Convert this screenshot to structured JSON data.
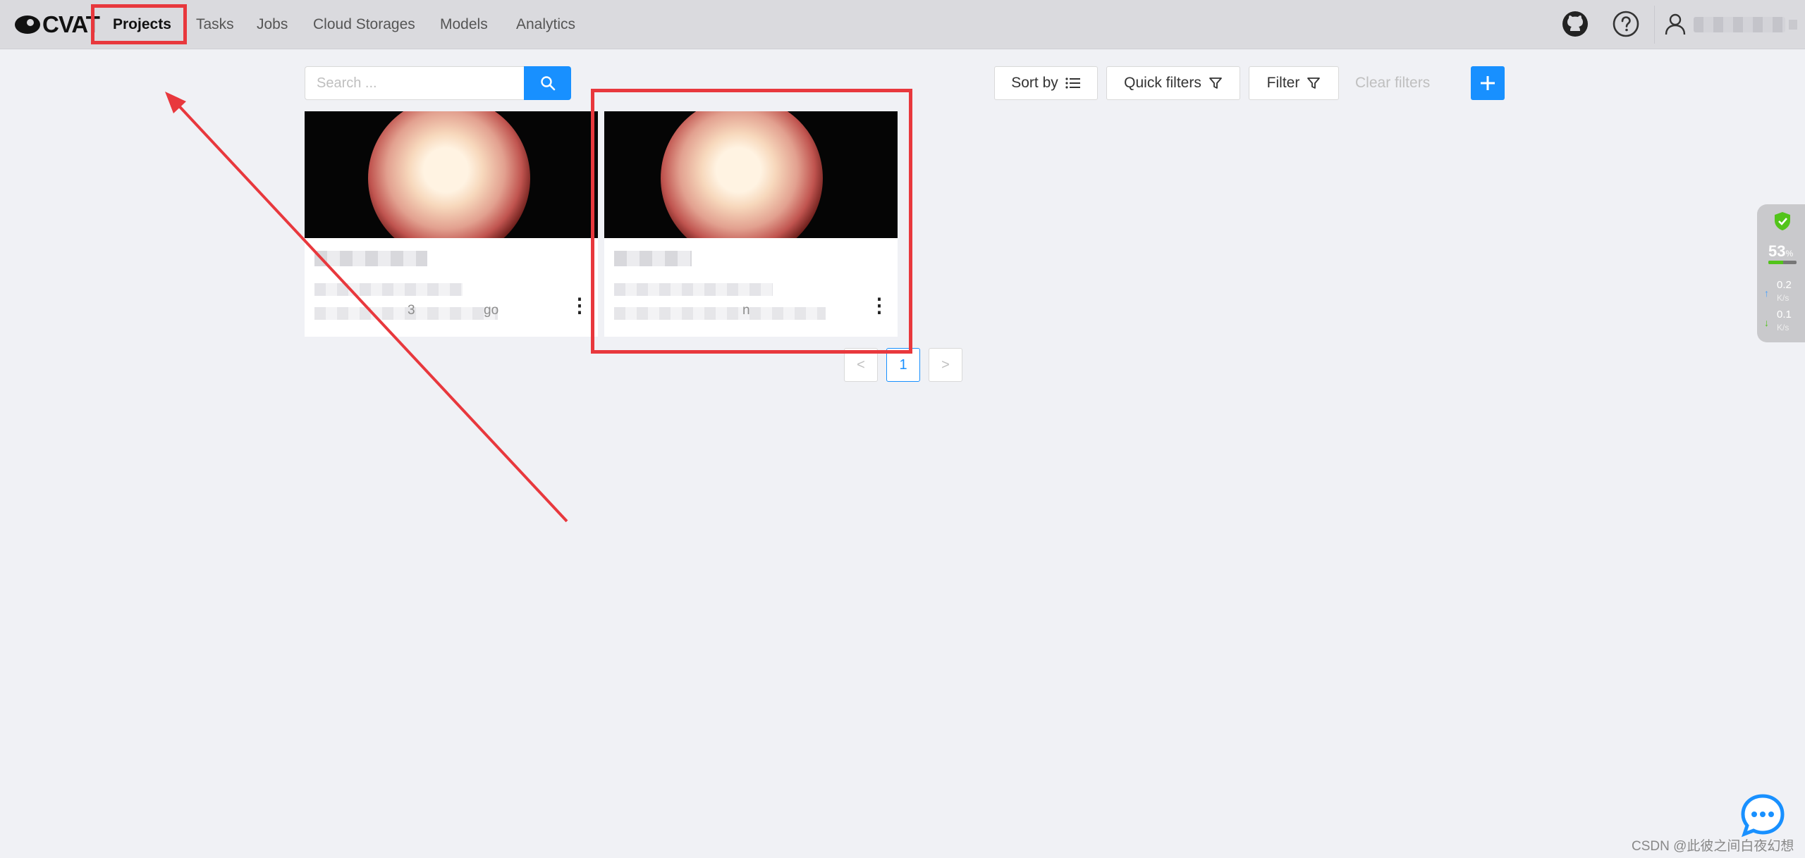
{
  "header": {
    "logo_text": "CVAT",
    "nav": [
      {
        "label": "Projects",
        "active": true
      },
      {
        "label": "Tasks",
        "active": false
      },
      {
        "label": "Jobs",
        "active": false
      },
      {
        "label": "Cloud Storages",
        "active": false
      },
      {
        "label": "Models",
        "active": false
      },
      {
        "label": "Analytics",
        "active": false
      }
    ],
    "icons": [
      "github-icon",
      "help-icon",
      "user-icon"
    ]
  },
  "toolbar": {
    "search_placeholder": "Search ...",
    "sort_label": "Sort by",
    "quick_filters_label": "Quick filters",
    "filter_label": "Filter",
    "clear_filters_label": "Clear filters"
  },
  "cards": [
    {
      "meta_fragment_1": "3",
      "meta_fragment_2": "go"
    },
    {
      "meta_fragment_1": "n"
    }
  ],
  "pagination": {
    "prev": "<",
    "current_page": "1",
    "next": ">"
  },
  "side_widget": {
    "percent": "53",
    "percent_unit": "%",
    "percent_value": 0.53,
    "up_value": "0.2",
    "up_unit": "K/s",
    "down_value": "0.1",
    "down_unit": "K/s"
  },
  "watermark": "CSDN @此彼之间白夜幻想",
  "colors": {
    "accent": "#1890ff",
    "annotation_red": "#e8383d",
    "header_bg": "#dadade",
    "page_bg": "#f0f1f5"
  }
}
